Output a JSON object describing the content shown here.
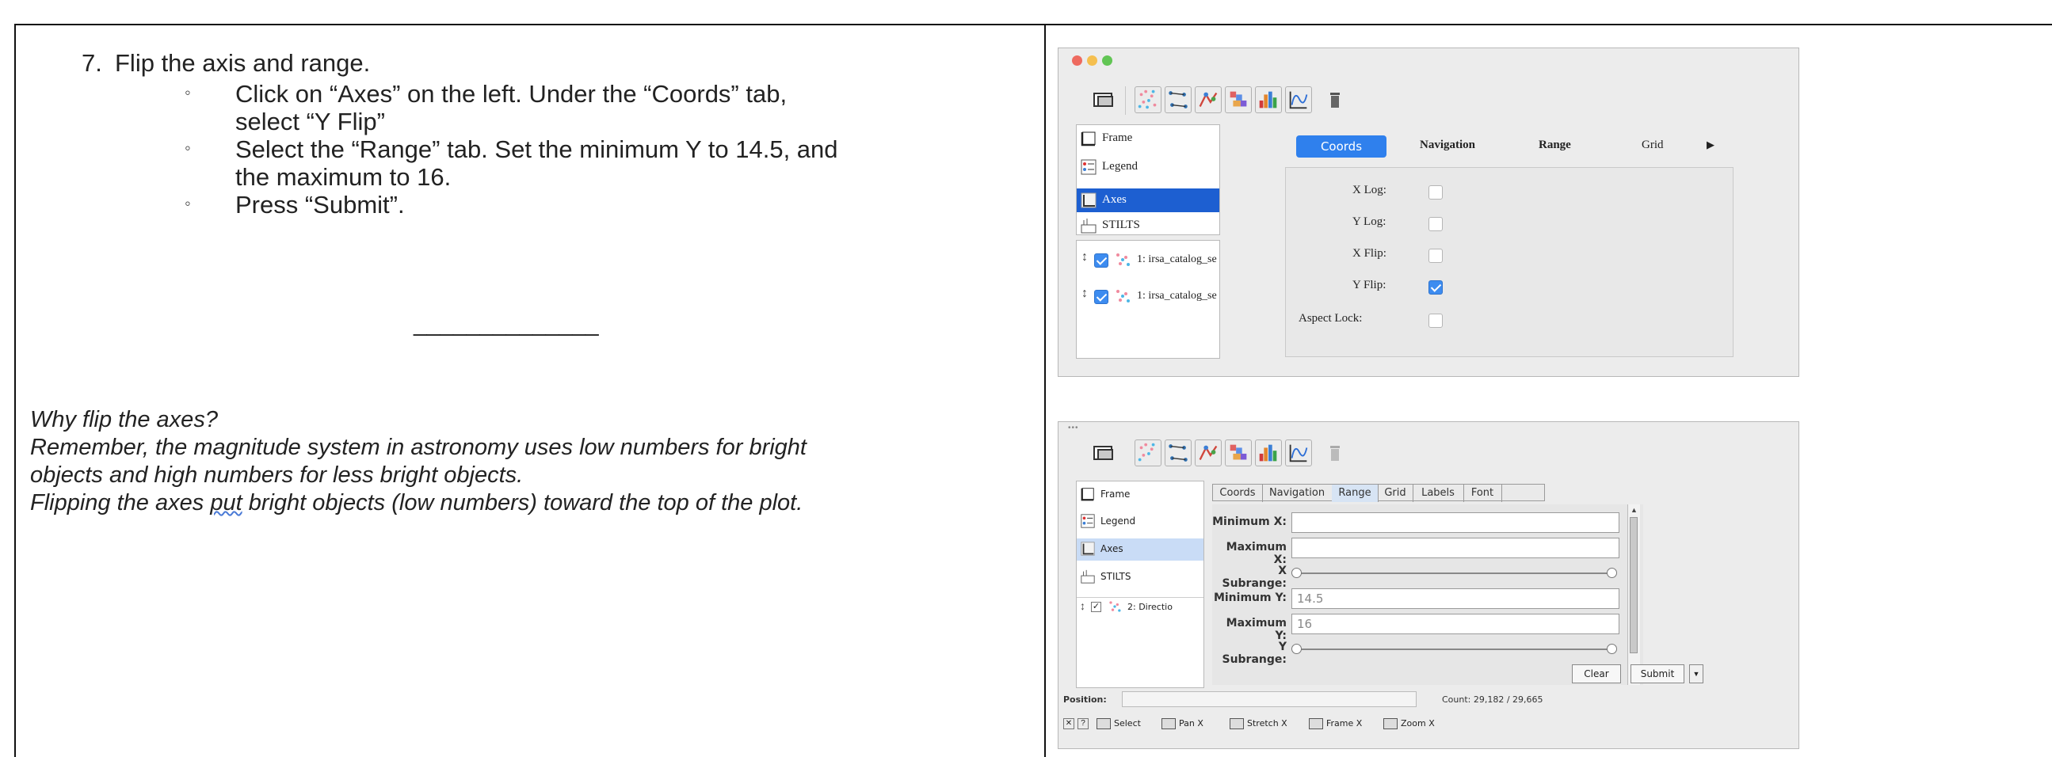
{
  "instructions": {
    "step_number": "7.",
    "step_title": "Flip the axis and range.",
    "bullet_1_line_1": "Click on “Axes” on the left. Under the “Coords” tab,",
    "bullet_1_line_2": "select “Y Flip”",
    "bullet_2_line_1": "Select the “Range” tab. Set the minimum Y to 14.5, and",
    "bullet_2_line_2": "the maximum to 16.",
    "bullet_3": "Press “Submit”.",
    "blank_line": "______________",
    "why_title": "Why flip the axes?",
    "why_line_1": "Remember, the magnitude system in astronomy uses low numbers for bright",
    "why_line_2": "objects and high numbers for less bright objects.",
    "why_line_3_a": "Flipping the axes ",
    "why_line_3_b": "put",
    "why_line_3_c": " bright objects (low numbers) toward the top of the plot."
  },
  "screenshot1": {
    "sidebar": {
      "frame": "Frame",
      "legend": "Legend",
      "axes": "Axes",
      "stilts": "STILTS",
      "layer_1": "1: irsa_catalog_se",
      "layer_2": "1: irsa_catalog_se"
    },
    "tabs": {
      "coords": "Coords",
      "navigation": "Navigation",
      "range": "Range",
      "grid": "Grid",
      "more": "▶"
    },
    "fields": {
      "x_log": "X Log:",
      "y_log": "Y Log:",
      "x_flip": "X Flip:",
      "y_flip": "Y Flip:",
      "aspect_lock": "Aspect Lock:"
    },
    "checked": {
      "x_log": false,
      "y_log": false,
      "x_flip": false,
      "y_flip": true,
      "aspect_lock": false
    },
    "accent_color": "#3d8cf0"
  },
  "screenshot2": {
    "sidebar": {
      "frame": "Frame",
      "legend": "Legend",
      "axes": "Axes",
      "stilts": "STILTS",
      "layer_1": "2: Directio"
    },
    "tabs": {
      "coords": "Coords",
      "navigation": "Navigation",
      "range": "Range",
      "grid": "Grid",
      "labels": "Labels",
      "font": "Font"
    },
    "fields": {
      "min_x": "Minimum X:",
      "max_x": "Maximum X:",
      "x_subrange": "X Subrange:",
      "min_y": "Minimum Y:",
      "max_y": "Maximum Y:",
      "y_subrange": "Y Subrange:"
    },
    "values": {
      "min_x": "",
      "max_x": "",
      "min_y": "14.5",
      "max_y": "16"
    },
    "buttons": {
      "clear": "Clear",
      "submit": "Submit"
    },
    "status": {
      "position": "Position:",
      "count": "Count: 29,182 / 29,665"
    },
    "modes": {
      "select": "Select",
      "pan_x": "Pan X",
      "stretch_x": "Stretch X",
      "frame_x": "Frame X",
      "zoom_x": "Zoom X"
    }
  }
}
